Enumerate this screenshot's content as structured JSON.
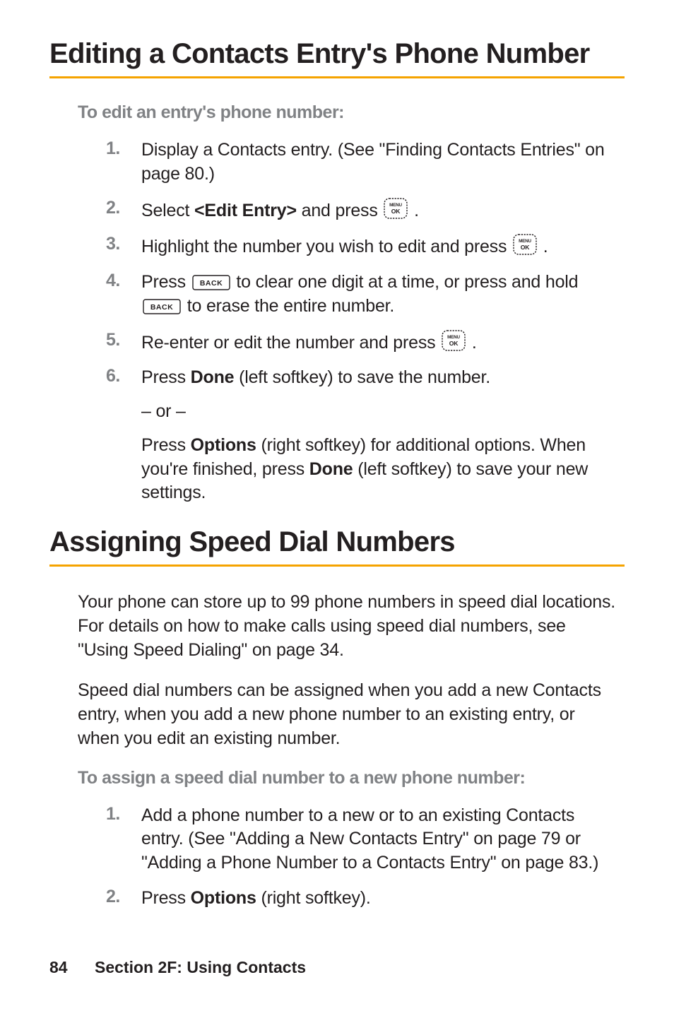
{
  "section1": {
    "title": "Editing a Contacts Entry's Phone Number",
    "subhead": "To edit an entry's phone number:",
    "steps": [
      {
        "num": "1.",
        "parts": [
          {
            "t": "text",
            "v": "Display a Contacts entry. (See \"Finding Contacts Entries\" on page 80.)"
          }
        ]
      },
      {
        "num": "2.",
        "parts": [
          {
            "t": "text",
            "v": "Select "
          },
          {
            "t": "bold",
            "v": "<Edit Entry>"
          },
          {
            "t": "text",
            "v": " and press "
          },
          {
            "t": "icon",
            "v": "menu-ok"
          },
          {
            "t": "text",
            "v": " ."
          }
        ]
      },
      {
        "num": "3.",
        "parts": [
          {
            "t": "text",
            "v": "Highlight the number you wish to edit and press "
          },
          {
            "t": "icon",
            "v": "menu-ok"
          },
          {
            "t": "text",
            "v": " ."
          }
        ]
      },
      {
        "num": "4.",
        "parts": [
          {
            "t": "text",
            "v": "Press "
          },
          {
            "t": "icon",
            "v": "back"
          },
          {
            "t": "text",
            "v": " to clear one digit at a time, or press and hold "
          },
          {
            "t": "icon",
            "v": "back"
          },
          {
            "t": "text",
            "v": " to erase the entire number."
          }
        ]
      },
      {
        "num": "5.",
        "parts": [
          {
            "t": "text",
            "v": "Re-enter or edit the number and press "
          },
          {
            "t": "icon",
            "v": "menu-ok"
          },
          {
            "t": "text",
            "v": " ."
          }
        ]
      },
      {
        "num": "6.",
        "parts": [
          {
            "t": "text",
            "v": "Press "
          },
          {
            "t": "bold",
            "v": "Done"
          },
          {
            "t": "text",
            "v": " (left softkey) to save the number."
          }
        ],
        "sub": [
          {
            "parts": [
              {
                "t": "text",
                "v": "– or –"
              }
            ]
          },
          {
            "parts": [
              {
                "t": "text",
                "v": "Press "
              },
              {
                "t": "bold",
                "v": "Options"
              },
              {
                "t": "text",
                "v": " (right softkey) for additional options. When you're finished, press "
              },
              {
                "t": "bold",
                "v": "Done"
              },
              {
                "t": "text",
                "v": " (left softkey) to save your new settings."
              }
            ]
          }
        ]
      }
    ]
  },
  "section2": {
    "title": "Assigning Speed Dial Numbers",
    "para1": "Your phone can store up to 99 phone numbers in speed dial locations. For details on how to make calls using speed dial numbers, see \"Using Speed Dialing\" on page 34.",
    "para2": "Speed dial numbers can be assigned when you add a new Contacts entry, when you add a new phone number to an existing entry, or when you edit an existing number.",
    "subhead": "To assign a speed dial number to a new phone number:",
    "steps": [
      {
        "num": "1.",
        "parts": [
          {
            "t": "text",
            "v": "Add a phone number to a new or to an existing Contacts entry. (See \"Adding a New Contacts Entry\" on page 79 or \"Adding a Phone Number to a Contacts Entry\" on page 83.)"
          }
        ]
      },
      {
        "num": "2.",
        "parts": [
          {
            "t": "text",
            "v": "Press "
          },
          {
            "t": "bold",
            "v": "Options"
          },
          {
            "t": "text",
            "v": " (right softkey)."
          }
        ]
      }
    ]
  },
  "footer": {
    "page": "84",
    "section": "Section 2F: Using Contacts"
  },
  "icons": {
    "menu-ok": {
      "label_top": "MENU",
      "label_bot": "OK"
    },
    "back": {
      "label": "BACK"
    }
  }
}
